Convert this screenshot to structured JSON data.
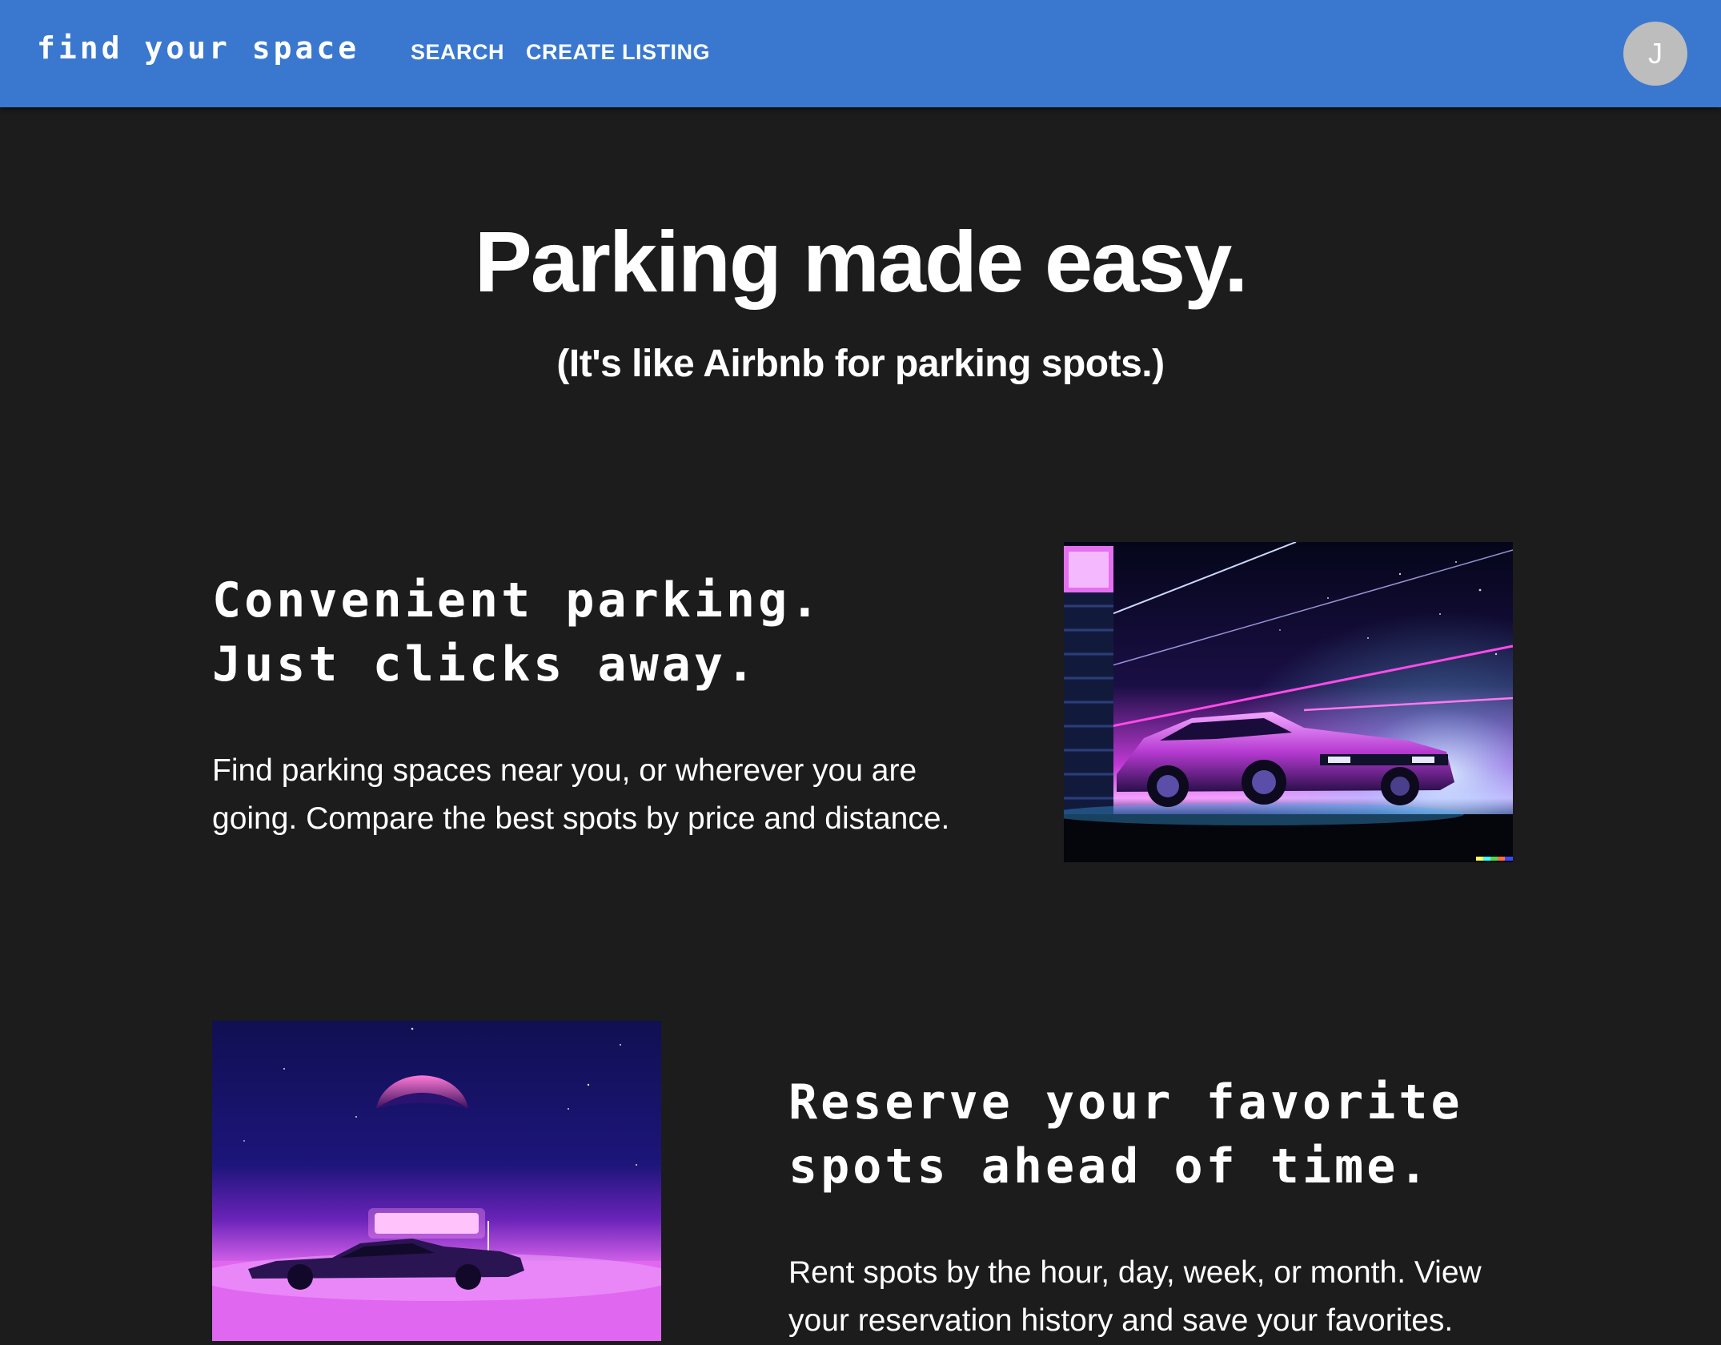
{
  "navbar": {
    "brand": "find your space",
    "links": [
      {
        "label": "SEARCH"
      },
      {
        "label": "CREATE LISTING"
      }
    ],
    "avatar_initial": "J",
    "color": "#3a78cf"
  },
  "hero": {
    "title": "Parking made easy.",
    "subtitle": "(It's like Airbnb for parking spots.)"
  },
  "features": [
    {
      "heading_line1": "Convenient parking.",
      "heading_line2": "Just clicks away.",
      "text": "Find parking spaces near you, or wherever you are going. Compare the best spots by price and distance.",
      "image": "synthwave-car-image"
    },
    {
      "heading_line1": "Reserve your favorite",
      "heading_line2": "spots ahead of time.",
      "text": "Rent spots by the hour, day, week, or month. View your reservation history and save your favorites.",
      "image": "synthwave-car-moon-image"
    }
  ],
  "colors": {
    "background": "#1c1c1d",
    "accent": "#3a78cf",
    "neon_pink": "#ff3cf0",
    "neon_purple": "#7a2bd6"
  }
}
